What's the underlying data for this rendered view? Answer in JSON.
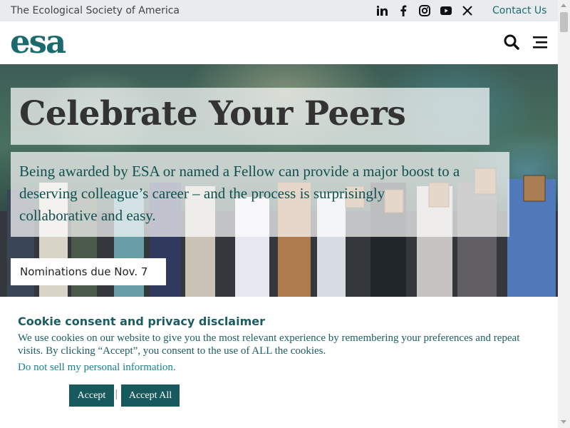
{
  "topbar": {
    "org_name": "The Ecological Society of America",
    "social_icons": [
      "linkedin-icon",
      "facebook-icon",
      "instagram-icon",
      "youtube-icon",
      "x-icon"
    ],
    "contact_label": "Contact Us"
  },
  "header": {
    "logo_text": "esa",
    "icons": [
      "search-icon",
      "menu-icon"
    ]
  },
  "hero": {
    "title": "Celebrate Your Peers",
    "description": "Being awarded by ESA or named a Fellow can provide a major boost to a deserving colleague’s career – and the process is surprisingly collaborative and easy.",
    "deadline": "Nominations due Nov. 7"
  },
  "cookie": {
    "title": "Cookie consent and privacy disclaimer",
    "text": "We use cookies on our website to give you the most relevant experience by remembering your preferences and repeat visits. By clicking “Accept”, you consent to the use of ALL the cookies.",
    "link_label": "Do not sell my personal information.",
    "accept_label": "Accept",
    "separator": "|",
    "accept_all_label": "Accept All"
  },
  "colors": {
    "brand_teal": "#1a6a6e",
    "button_teal": "#17595c",
    "topbar_bg": "#e9ecee"
  }
}
